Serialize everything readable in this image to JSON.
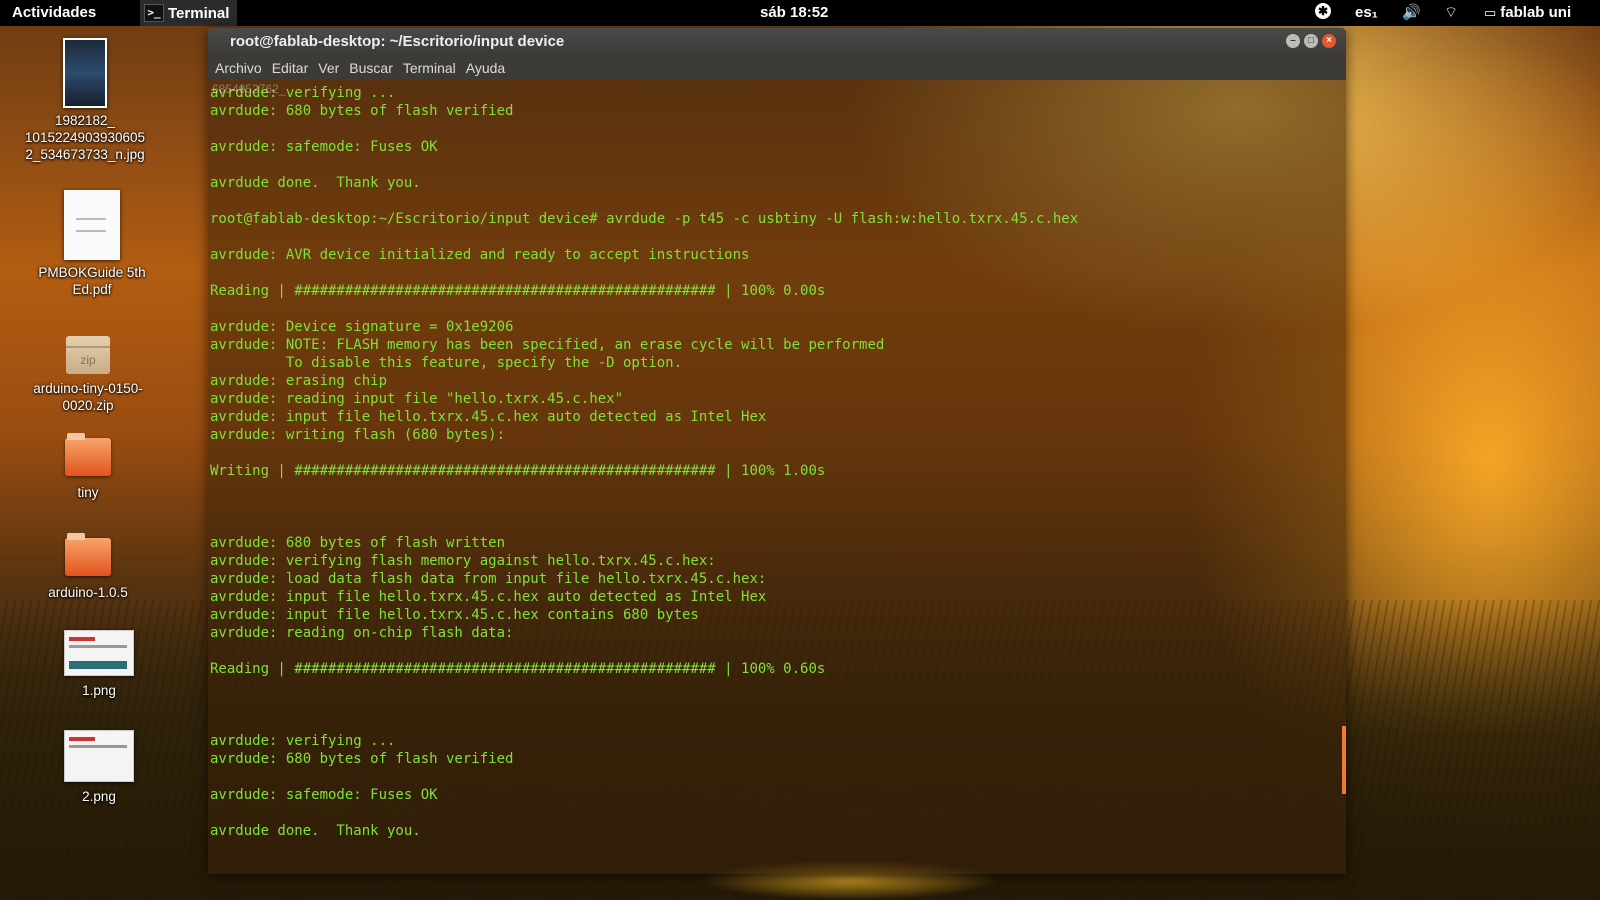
{
  "topbar": {
    "activities": "Actividades",
    "app_name": "Terminal",
    "clock": "sáb 18:52",
    "keyboard_layout": "es₁",
    "user": "fablab uni"
  },
  "desktop_icons": [
    {
      "label": "1982182_\n1015224903930605\n2_534673733_n.jpg",
      "type": "jpg"
    },
    {
      "label": "PMBOKGuide 5th\nEd.pdf",
      "type": "pdf"
    },
    {
      "label": "arduino-tiny-0150-\n0020.zip",
      "type": "zip",
      "badge": "zip"
    },
    {
      "label": "tiny",
      "type": "folder"
    },
    {
      "label": "arduino-1.0.5",
      "type": "folder"
    },
    {
      "label": "1.png",
      "type": "png"
    },
    {
      "label": "2.png",
      "type": "png"
    }
  ],
  "terminal": {
    "title": "root@fablab-desktop: ~/Escritorio/input device",
    "ghost_label": "6854952762_",
    "menu": [
      "Archivo",
      "Editar",
      "Ver",
      "Buscar",
      "Terminal",
      "Ayuda"
    ],
    "lines": [
      "avrdude: verifying ...",
      "avrdude: 680 bytes of flash verified",
      "",
      "avrdude: safemode: Fuses OK",
      "",
      "avrdude done.  Thank you.",
      "",
      "root@fablab-desktop:~/Escritorio/input device# avrdude -p t45 -c usbtiny -U flash:w:hello.txrx.45.c.hex",
      "",
      "avrdude: AVR device initialized and ready to accept instructions",
      "",
      "Reading | ################################################## | 100% 0.00s",
      "",
      "avrdude: Device signature = 0x1e9206",
      "avrdude: NOTE: FLASH memory has been specified, an erase cycle will be performed",
      "         To disable this feature, specify the -D option.",
      "avrdude: erasing chip",
      "avrdude: reading input file \"hello.txrx.45.c.hex\"",
      "avrdude: input file hello.txrx.45.c.hex auto detected as Intel Hex",
      "avrdude: writing flash (680 bytes):",
      "",
      "Writing | ################################################## | 100% 1.00s",
      "",
      "",
      "",
      "avrdude: 680 bytes of flash written",
      "avrdude: verifying flash memory against hello.txrx.45.c.hex:",
      "avrdude: load data flash data from input file hello.txrx.45.c.hex:",
      "avrdude: input file hello.txrx.45.c.hex auto detected as Intel Hex",
      "avrdude: input file hello.txrx.45.c.hex contains 680 bytes",
      "avrdude: reading on-chip flash data:",
      "",
      "Reading | ################################################## | 100% 0.60s",
      "",
      "",
      "",
      "avrdude: verifying ...",
      "avrdude: 680 bytes of flash verified",
      "",
      "avrdude: safemode: Fuses OK",
      "",
      "avrdude done.  Thank you."
    ]
  },
  "colors": {
    "terminal_text": "#80e03a",
    "close_button": "#e5582a",
    "scroll_indicator": "#f07a30"
  }
}
